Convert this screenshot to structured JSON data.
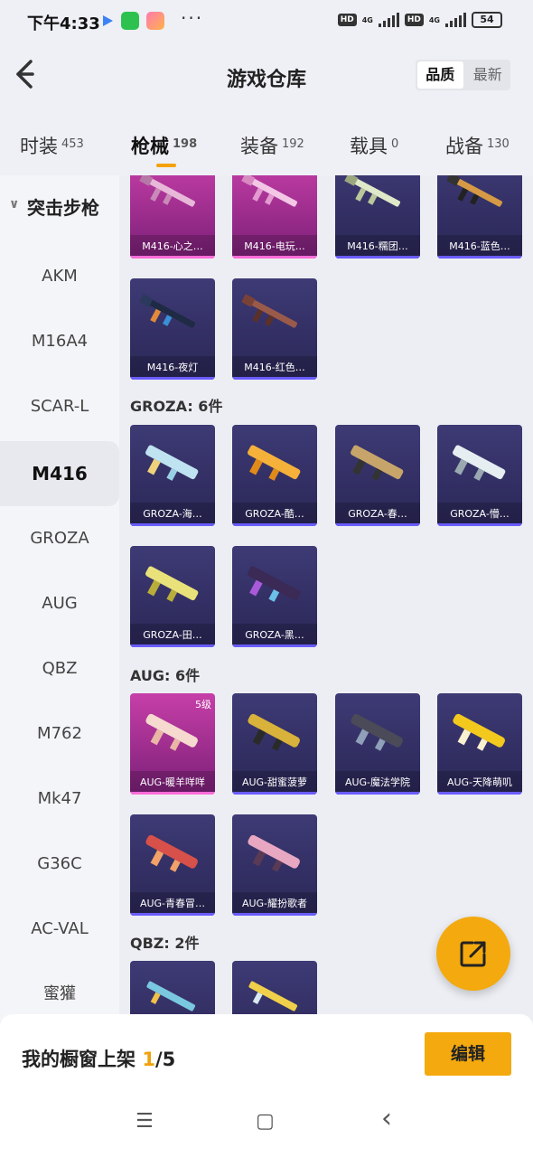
{
  "status": {
    "time": "下午4:33",
    "dots": "···",
    "hd1": "HD",
    "net1": "4G",
    "hd2": "HD",
    "net2": "4G",
    "battery": "54"
  },
  "header": {
    "title": "游戏仓库",
    "sort_quality": "品质",
    "sort_latest": "最新"
  },
  "tabs": [
    {
      "label": "时装",
      "count": "453"
    },
    {
      "label": "枪械",
      "count": "198",
      "active": true
    },
    {
      "label": "装备",
      "count": "192"
    },
    {
      "label": "载具",
      "count": "0"
    },
    {
      "label": "战备",
      "count": "130"
    }
  ],
  "sidebar": {
    "group": "突击步枪",
    "items": [
      "AKM",
      "M16A4",
      "SCAR-L",
      "M416",
      "GROZA",
      "AUG",
      "QBZ",
      "M762",
      "Mk47",
      "G36C",
      "AC-VAL",
      "蜜獾"
    ],
    "active": "M416"
  },
  "sections": {
    "groza_header": "GROZA: 6件",
    "aug_header": "AUG: 6件",
    "qbz_header": "QBZ: 2件"
  },
  "cards": {
    "m416": [
      "M416-心之…",
      "M416-电玩…",
      "M416-糯团…",
      "M416-蓝色…",
      "M416-夜灯",
      "M416-红色…"
    ],
    "groza": [
      "GROZA-海…",
      "GROZA-酷…",
      "GROZA-春…",
      "GROZA-懵…",
      "GROZA-田…",
      "GROZA-黑…"
    ],
    "aug": [
      "AUG-暖羊咩咩",
      "AUG-甜蜜菠萝",
      "AUG-魔法学院",
      "AUG-天降萌叽",
      "AUG-青春冒…",
      "AUG-耀扮歌者"
    ],
    "aug_level": "5级"
  },
  "bottom": {
    "label": "我的橱窗上架 ",
    "current": "1",
    "total": "/5",
    "edit": "编辑"
  },
  "nav": {
    "menu": "☰",
    "home": "▢",
    "back": "‹"
  }
}
